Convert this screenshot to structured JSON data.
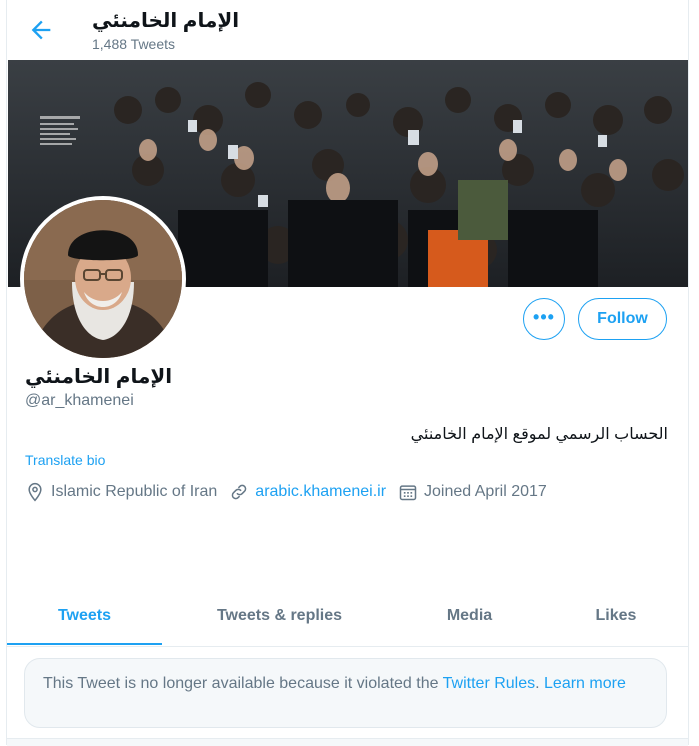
{
  "header": {
    "name": "الإمام الخامنئي",
    "tweet_count": "1,488 Tweets",
    "back_icon": "arrow-left-icon"
  },
  "profile": {
    "name": "الإمام الخامنئي",
    "handle": "@ar_khamenei",
    "bio": "الحساب الرسمي لموقع الإمام الخامنئي",
    "translate_label": "Translate bio",
    "location": "Islamic Republic of Iran",
    "website": "arabic.khamenei.ir",
    "joined": "Joined April 2017",
    "more_label": "•••",
    "follow_label": "Follow"
  },
  "tabs": [
    {
      "label": "Tweets",
      "active": true
    },
    {
      "label": "Tweets & replies",
      "active": false
    },
    {
      "label": "Media",
      "active": false
    },
    {
      "label": "Likes",
      "active": false
    }
  ],
  "notice": {
    "text": "This Tweet is no longer available because it violated the ",
    "rules_link": "Twitter Rules",
    "separator": ". ",
    "learn_more": "Learn more"
  },
  "colors": {
    "accent": "#1da1f2",
    "secondary_text": "#657786",
    "border": "#e6ecf0"
  }
}
